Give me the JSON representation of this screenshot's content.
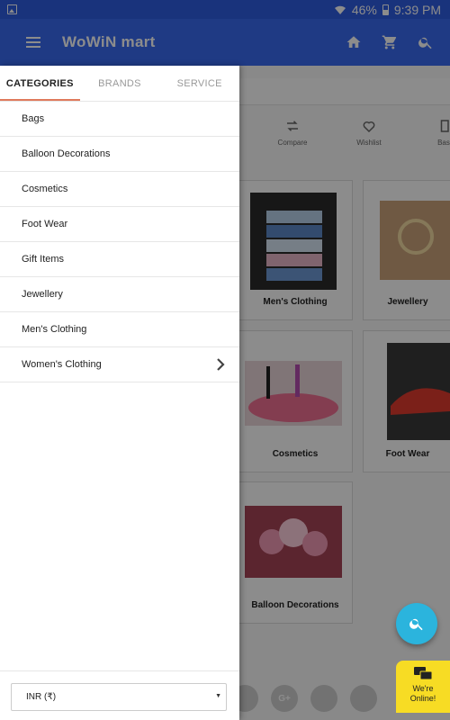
{
  "status_bar": {
    "battery": "46%",
    "time": "9:39 PM"
  },
  "app_bar": {
    "title": "WoWiN mart",
    "icons": [
      "menu-icon",
      "home-icon",
      "cart-icon",
      "search-icon"
    ]
  },
  "background": {
    "quick_actions": [
      {
        "label": "Compare",
        "icon": "compare-icon"
      },
      {
        "label": "Wishlist",
        "icon": "heart-icon"
      },
      {
        "label": "Bask",
        "icon": "basket-icon"
      }
    ],
    "cards": [
      {
        "name": "Men's Clothing"
      },
      {
        "name": "Jewellery"
      },
      {
        "name": "Cosmetics"
      },
      {
        "name": "Foot Wear"
      },
      {
        "name": "Balloon Decorations"
      }
    ],
    "social": [
      "G+"
    ]
  },
  "drawer": {
    "tabs": [
      {
        "label": "CATEGORIES",
        "active": true
      },
      {
        "label": "BRANDS",
        "active": false
      },
      {
        "label": "SERVICE",
        "active": false
      }
    ],
    "categories": [
      {
        "label": "Bags"
      },
      {
        "label": "Balloon Decorations"
      },
      {
        "label": "Cosmetics"
      },
      {
        "label": "Foot Wear"
      },
      {
        "label": "Gift Items"
      },
      {
        "label": "Jewellery"
      },
      {
        "label": "Men's Clothing"
      },
      {
        "label": "Women's Clothing",
        "has_children": true
      }
    ],
    "currency": {
      "selected": "INR (₹)"
    }
  },
  "chat": {
    "line1": "We're",
    "line2": "Online!"
  },
  "colors": {
    "primary": "#3a6bf0",
    "status_bar": "#2f5de2",
    "accent": "#e07a5c",
    "fab": "#2bb4dd",
    "chat": "#f7dc24"
  }
}
